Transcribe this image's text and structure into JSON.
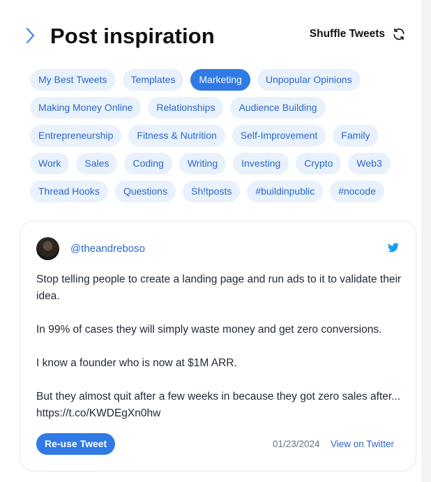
{
  "header": {
    "title": "Post inspiration",
    "shuffle_label": "Shuffle Tweets"
  },
  "chips": {
    "rows": [
      [
        "My Best Tweets",
        "Templates",
        "Marketing",
        "Unpopular Opinions"
      ],
      [
        "Making Money Online",
        "Relationships",
        "Audience Building"
      ],
      [
        "Entrepreneurship",
        "Fitness & Nutrition",
        "Self-Improvement",
        "Family"
      ],
      [
        "Work",
        "Sales",
        "Coding",
        "Writing",
        "Investing",
        "Crypto",
        "Web3"
      ],
      [
        "Thread Hooks",
        "Questions",
        "Sh!tposts",
        "#buildinpublic",
        "#nocode"
      ]
    ],
    "active": "Marketing"
  },
  "tweet": {
    "handle": "@theandreboso",
    "paragraphs": [
      "Stop telling people to create a landing page and run ads to it to validate their idea.",
      "In 99% of cases they will simply waste money and get zero conversions.",
      "I know a founder who is now at $1M ARR.",
      "But they almost quit after a few weeks in because they got zero sales after... https://t.co/KWDEgXn0hw"
    ],
    "reuse_label": "Re-use Tweet",
    "date": "01/23/2024",
    "view_label": "View on Twitter"
  },
  "colors": {
    "accent": "#2f7ae5",
    "chip_bg": "#e8f1fc",
    "chip_text": "#2a66c9"
  },
  "icons": {
    "back": "chevron-right-icon",
    "shuffle": "refresh-icon",
    "brand": "twitter-icon"
  }
}
